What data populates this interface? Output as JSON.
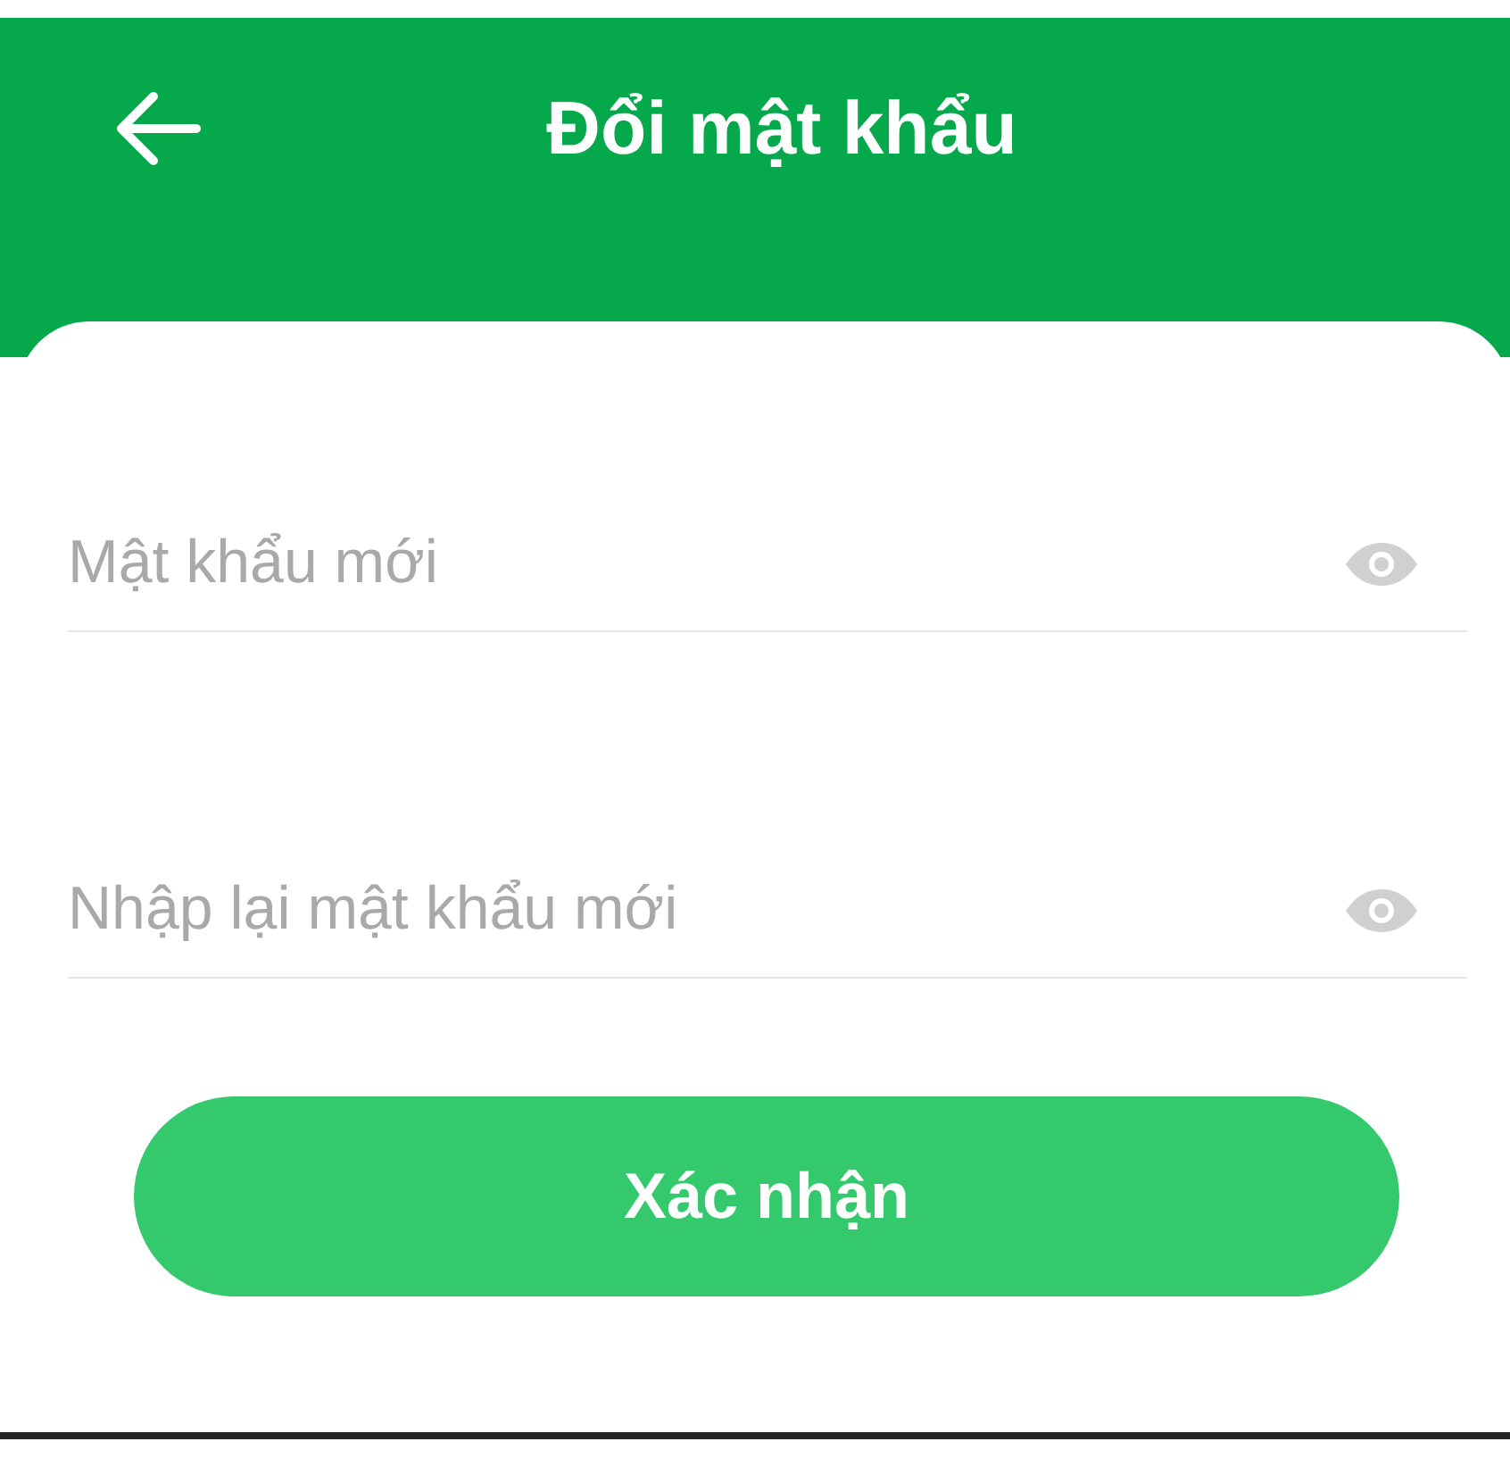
{
  "header": {
    "title": "Đổi mật khẩu"
  },
  "fields": [
    {
      "placeholder": "Mật khẩu mới"
    },
    {
      "placeholder": "Nhập lại mật khẩu mới"
    }
  ],
  "submit_button": {
    "label": "Xác nhận"
  }
}
